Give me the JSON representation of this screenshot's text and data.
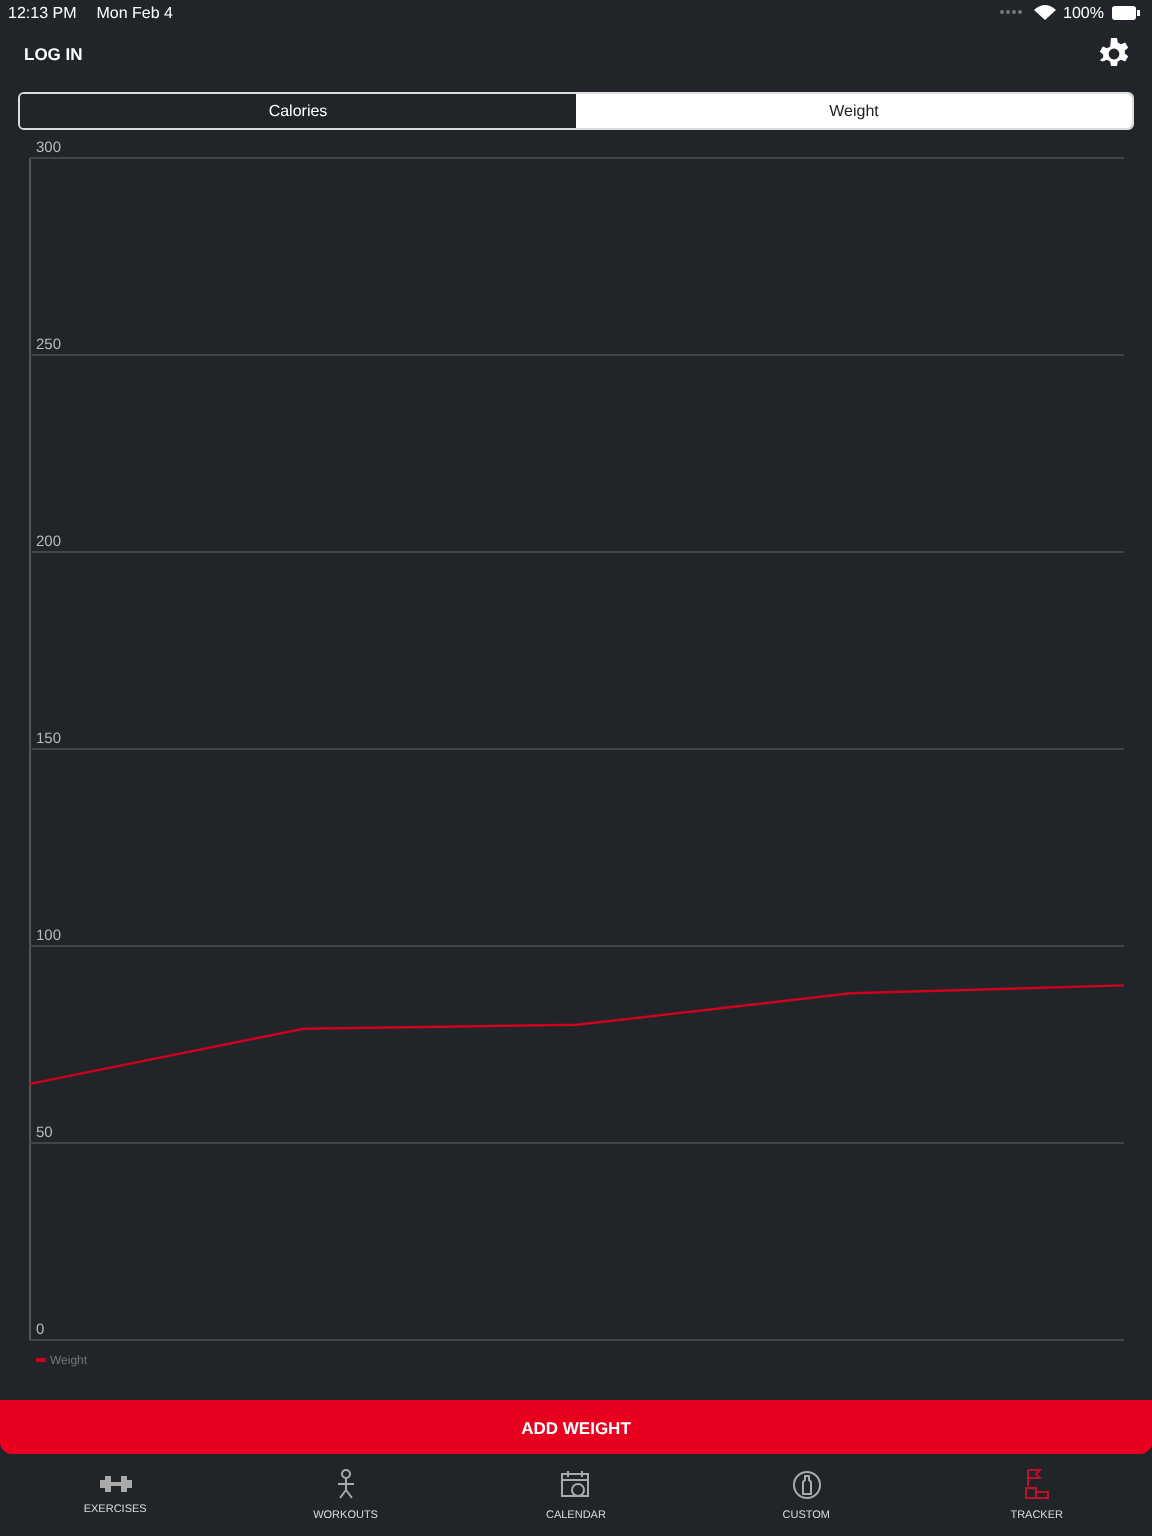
{
  "status_bar": {
    "time": "12:13 PM",
    "date": "Mon Feb 4",
    "battery": "100%"
  },
  "header": {
    "login": "LOG IN"
  },
  "segments": [
    {
      "label": "Calories",
      "selected": false
    },
    {
      "label": "Weight",
      "selected": true
    }
  ],
  "chart_data": {
    "type": "line",
    "grid": true,
    "series": [
      {
        "name": "Weight",
        "color": "#d0021b",
        "values": [
          65,
          79,
          80,
          88,
          90
        ]
      }
    ],
    "ylim": [
      0,
      300
    ],
    "yticks": [
      0,
      50,
      100,
      150,
      200,
      250,
      300
    ]
  },
  "add_button": "ADD WEIGHT",
  "tabs": [
    {
      "kind": "exercises",
      "label": "EXERCISES",
      "selected": false
    },
    {
      "kind": "workouts",
      "label": "WORKOUTS",
      "selected": false
    },
    {
      "kind": "calendar",
      "label": "CALENDAR",
      "selected": false
    },
    {
      "kind": "custom",
      "label": "CUSTOM",
      "selected": false
    },
    {
      "kind": "tracker",
      "label": "TRACKER",
      "selected": true
    }
  ]
}
